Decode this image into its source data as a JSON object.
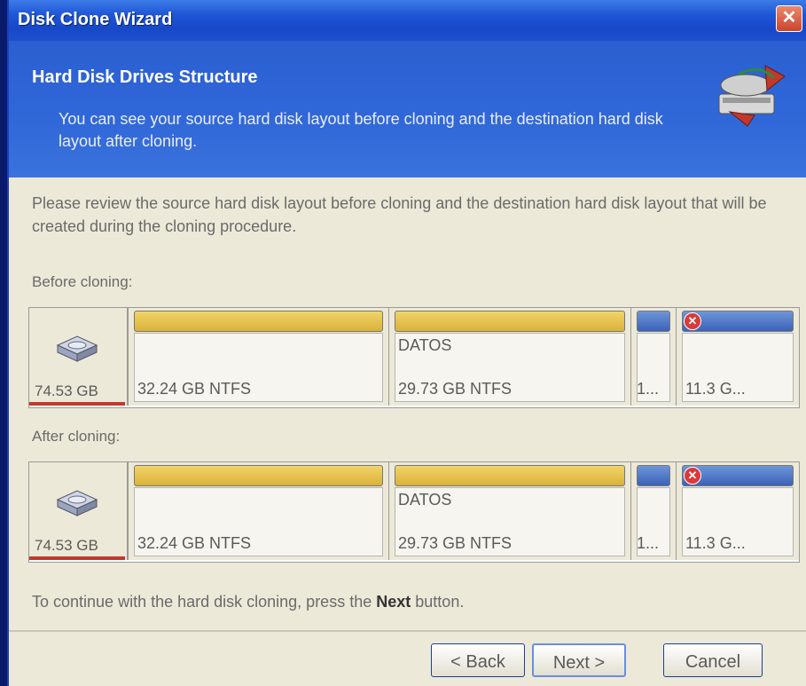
{
  "window": {
    "title": "Disk Clone Wizard",
    "close_label": "✕"
  },
  "header": {
    "title": "Hard Disk Drives Structure",
    "description": "You can see your source hard disk layout before cloning and the destination hard disk layout after cloning."
  },
  "intro_text": "Please review the source hard disk layout before cloning and the destination hard disk layout that will be created during the cloning procedure.",
  "before": {
    "label": "Before cloning:",
    "disk_size": "74.53 GB",
    "partitions": [
      {
        "name": "",
        "size": "32.24 GB  NTFS"
      },
      {
        "name": "DATOS",
        "size": "29.73 GB  NTFS"
      },
      {
        "name": "",
        "size": "1..."
      },
      {
        "name": "",
        "size": "11.3 G..."
      }
    ]
  },
  "after": {
    "label": "After cloning:",
    "disk_size": "74.53 GB",
    "partitions": [
      {
        "name": "",
        "size": "32.24 GB  NTFS"
      },
      {
        "name": "DATOS",
        "size": "29.73 GB  NTFS"
      },
      {
        "name": "",
        "size": "1..."
      },
      {
        "name": "",
        "size": "11.3 G..."
      }
    ]
  },
  "footer": {
    "prefix": "To continue with the hard disk cloning, press the",
    "bold": "Next",
    "suffix": "button."
  },
  "buttons": {
    "back": "< Back",
    "next": "Next >",
    "cancel": "Cancel"
  },
  "colors": {
    "title_bar": "#1f57d6",
    "partition_primary": "#d9b23a",
    "partition_extended": "#3a62b8",
    "disk_marker": "#c0392b"
  }
}
